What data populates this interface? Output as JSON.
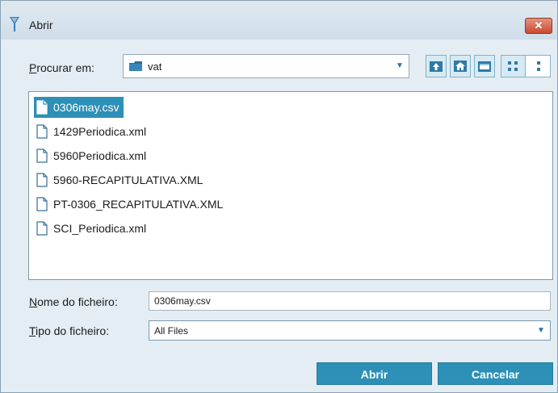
{
  "window": {
    "title": "Abrir",
    "close_label": "✕"
  },
  "lookin": {
    "label_prefix": "P",
    "label_rest": "rocurar em:",
    "value": "vat"
  },
  "toolbar": {
    "icons": [
      "up-folder-icon",
      "home-icon",
      "new-folder-icon",
      "list-view-icon",
      "details-view-icon"
    ]
  },
  "files": [
    {
      "name": "0306may.csv",
      "selected": true
    },
    {
      "name": "1429Periodica.xml",
      "selected": false
    },
    {
      "name": "5960Periodica.xml",
      "selected": false
    },
    {
      "name": "5960-RECAPITULATIVA.XML",
      "selected": false
    },
    {
      "name": "PT-0306_RECAPITULATIVA.XML",
      "selected": false
    },
    {
      "name": "SCI_Periodica.xml",
      "selected": false
    }
  ],
  "filename": {
    "label_prefix": "N",
    "label_rest": "ome do ficheiro:",
    "value": "0306may.csv"
  },
  "filetype": {
    "label_prefix": "T",
    "label_rest": "ipo do ficheiro:",
    "value": "All Files"
  },
  "buttons": {
    "open": "Abrir",
    "cancel": "Cancelar"
  },
  "colors": {
    "accent": "#2c90b7",
    "window_bg": "#e4edf4",
    "close_red": "#c94b32"
  }
}
